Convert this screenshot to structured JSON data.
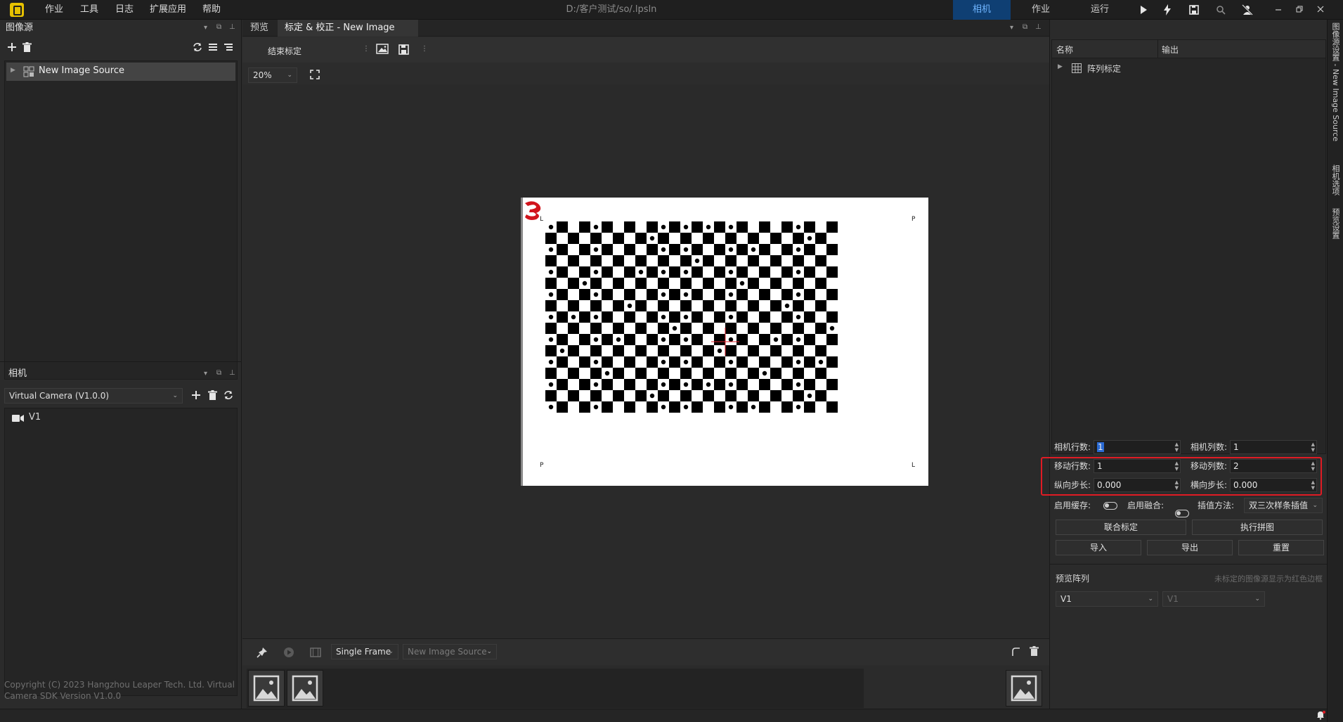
{
  "titlebar": {
    "menus": [
      "作业",
      "工具",
      "日志",
      "扩展应用",
      "帮助"
    ],
    "path": "D:/客户测试/so/.lpsln",
    "modes": [
      "相机",
      "作业",
      "运行"
    ],
    "active_mode": "相机"
  },
  "left_panel": {
    "image_source": {
      "title": "图像源",
      "items": [
        "New Image Source"
      ]
    },
    "camera": {
      "title": "相机",
      "selected_camera": "Virtual Camera (V1.0.0)",
      "items": [
        "V1"
      ]
    },
    "copyright": "Copyright (C) 2023 Hangzhou Leaper Tech. Ltd. Virtual Camera SDK Version V1.0.0"
  },
  "center": {
    "tabs": [
      "预览",
      "标定 & 校正 - New Image Source"
    ],
    "active_tab": 1,
    "toolbar": {
      "end_calibration": "结束标定",
      "zoom": "20%"
    },
    "image_corner_labels": {
      "top_left": "L",
      "top_right": "P",
      "bottom_left": "P",
      "bottom_right": "L"
    },
    "filmstrip": {
      "mode": "Single Frame",
      "source_placeholder": "New Image Source"
    }
  },
  "right_panel": {
    "columns": [
      "名称",
      "输出"
    ],
    "tree_items": [
      "阵列标定"
    ],
    "params": {
      "camera_rows_label": "相机行数:",
      "camera_rows": "1",
      "camera_cols_label": "相机列数:",
      "camera_cols": "1",
      "move_rows_label": "移动行数:",
      "move_rows": "1",
      "move_cols_label": "移动列数:",
      "move_cols": "2",
      "v_step_label": "纵向步长:",
      "v_step": "0.000",
      "h_step_label": "横向步长:",
      "h_step": "0.000",
      "enable_cache_label": "启用缓存:",
      "enable_fusion_label": "启用融合:",
      "interp_label": "插值方法:",
      "interp_method": "双三次样条插值"
    },
    "buttons": {
      "joint_calib": "联合标定",
      "stitch": "执行拼图",
      "import": "导入",
      "export": "导出",
      "reset": "重置"
    },
    "preview_array": {
      "title": "预览阵列",
      "hint": "未标定的图像源显示为红色边框",
      "select1": "V1",
      "select2": "V1"
    }
  },
  "vertical_tabs": [
    "图像源设置 - New Image Source",
    "相机选项",
    "预览设置"
  ],
  "colors": {
    "accent": "#0f3f73",
    "highlight_box": "#e01b24"
  }
}
